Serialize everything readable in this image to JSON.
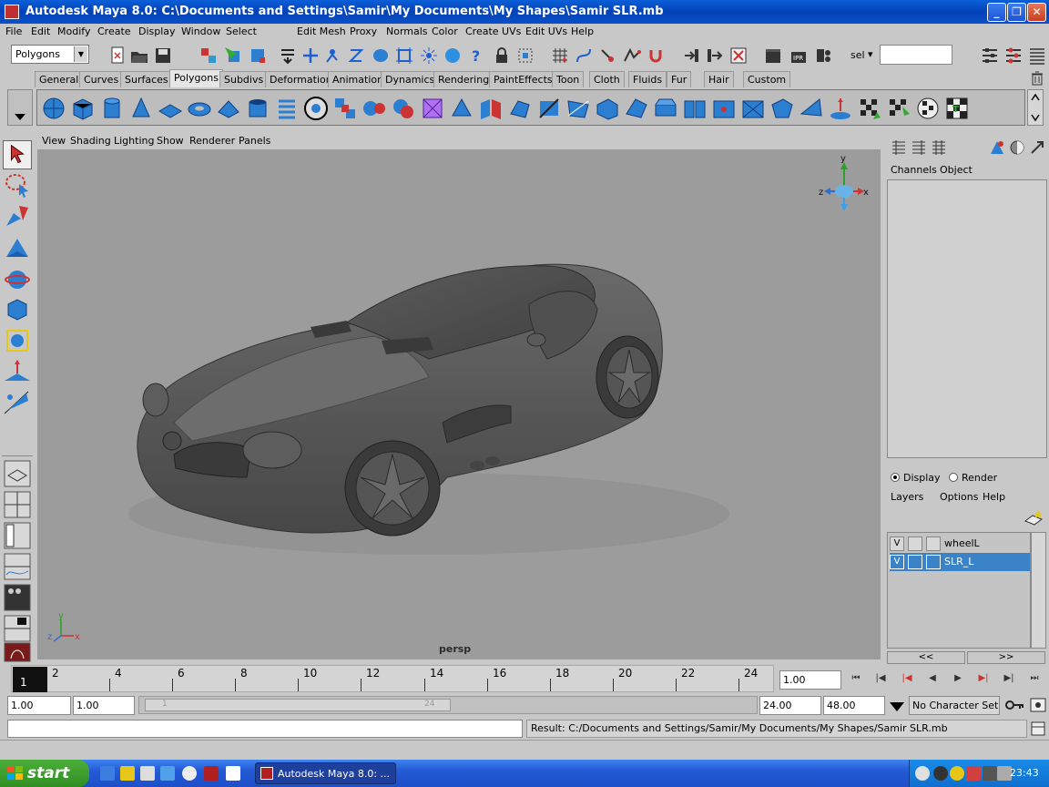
{
  "window": {
    "title": "Autodesk Maya 8.0: C:\\Documents and Settings\\Samir\\My Documents\\My Shapes\\Samir SLR.mb",
    "min_glyph": "_",
    "max_glyph": "❐",
    "close_glyph": "✕"
  },
  "menubar": [
    "File",
    "Edit",
    "Modify",
    "Create",
    "Display",
    "Window",
    "Select",
    "Edit Mesh",
    "Proxy",
    "Normals",
    "Color",
    "Create UVs",
    "Edit UVs",
    "Help"
  ],
  "status_line": {
    "mode": "Polygons",
    "mode_arrow": "▼",
    "sel_label": "sel",
    "sel_arrow": "▾",
    "sel_value": ""
  },
  "shelf": {
    "tabs": [
      "General",
      "Curves",
      "Surfaces",
      "Polygons",
      "Subdivs",
      "Deformation",
      "Animation",
      "Dynamics",
      "Rendering",
      "PaintEffects",
      "Toon",
      "Cloth",
      "Fluids",
      "Fur",
      "Hair",
      "Custom"
    ],
    "active_tab": "Polygons"
  },
  "viewport": {
    "menus": [
      "View",
      "Shading",
      "Lighting",
      "Show",
      "Renderer",
      "Panels"
    ],
    "camera_label": "persp",
    "gizmo_axes": {
      "y": "y",
      "z": "z",
      "x": "x"
    },
    "corner_axes": {
      "y": "y",
      "z": "z",
      "x": "x"
    }
  },
  "channel_box": {
    "labels": [
      "Channels",
      "Object"
    ]
  },
  "layers": {
    "mode_display": "Display",
    "mode_render": "Render",
    "menus": [
      "Layers",
      "Options",
      "Help"
    ],
    "rows": [
      {
        "visible": "V",
        "name": "wheelL",
        "selected": false
      },
      {
        "visible": "V",
        "name": "SLR_L",
        "selected": true
      }
    ],
    "prev_glyph": "<<",
    "next_glyph": ">>"
  },
  "timeline": {
    "current_frame": "1",
    "tick_labels": [
      "2",
      "4",
      "6",
      "8",
      "10",
      "12",
      "14",
      "16",
      "18",
      "20",
      "22",
      "24"
    ],
    "current_time": "1.00"
  },
  "playback_glyphs": [
    "⏮",
    "|◀",
    "|◀",
    "◀",
    "▶",
    "▶|",
    "▶|",
    "⏭"
  ],
  "range": {
    "start_time": "1.00",
    "playback_start": "1.00",
    "inner_start": "1",
    "inner_end": "24",
    "playback_end": "24.00",
    "end_time": "48.00",
    "char_set": "No Character Set"
  },
  "command_line": {
    "result": "Result: C:/Documents and Settings/Samir/My Documents/My Shapes/Samir SLR.mb"
  },
  "taskbar": {
    "start": "start",
    "task": "Autodesk Maya 8.0: ...",
    "clock": "23:43"
  },
  "colors": {
    "accent": "#3b83c9",
    "titlebar": "#0a50c8",
    "viewport_bg": "#9c9c9c",
    "car_body": "#5a5a5a"
  }
}
